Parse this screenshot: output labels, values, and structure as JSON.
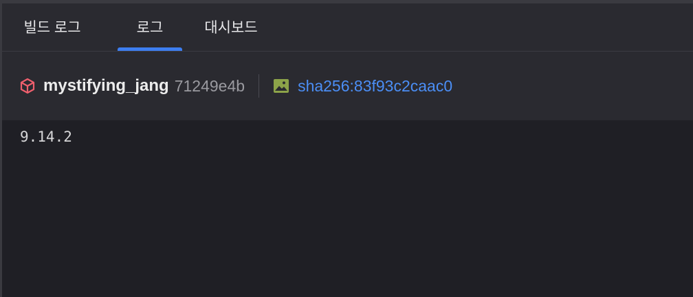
{
  "tabs": [
    {
      "label": "빌드 로그",
      "active": false
    },
    {
      "label": "로그",
      "active": true
    },
    {
      "label": "대시보드",
      "active": false
    }
  ],
  "container": {
    "icon": "cube-icon",
    "name": "mystifying_jang",
    "id": "71249e4b"
  },
  "image": {
    "icon": "image-icon",
    "sha": "sha256:83f93c2caac0"
  },
  "logs": {
    "lines": [
      "9.14.2"
    ]
  },
  "colors": {
    "accent": "#3d7ef0",
    "link": "#4b8ef5",
    "cube": "#ef5f6d",
    "image": "#8ca349"
  }
}
